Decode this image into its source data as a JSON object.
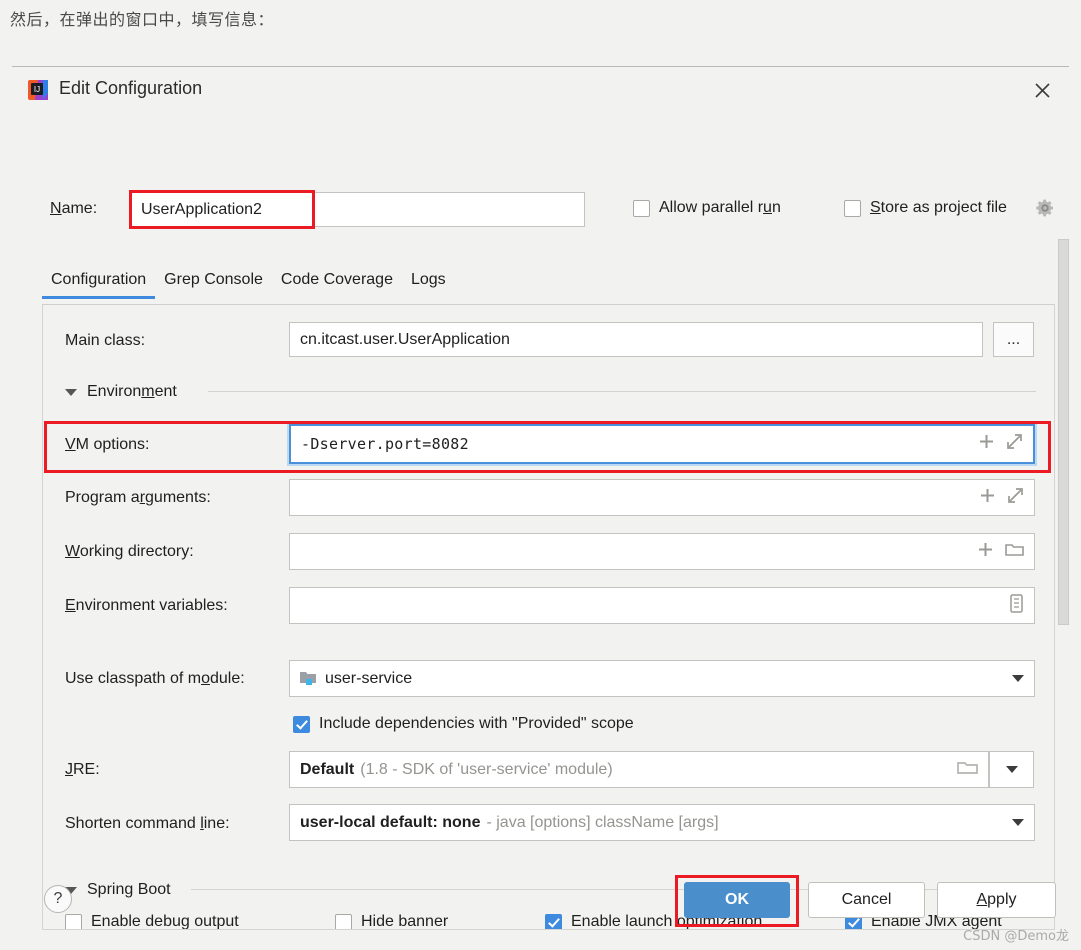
{
  "caption": "然后，在弹出的窗口中，填写信息：",
  "dialog": {
    "title": "Edit Configuration",
    "icon": "intellij-idea-icon",
    "close_icon": "close-icon"
  },
  "name_row": {
    "label": "Name:",
    "label_mnemonic": "N",
    "value": "UserApplication2",
    "placeholder": ""
  },
  "top_checkboxes": [
    {
      "label": "Allow parallel run",
      "mnemonic": "u",
      "checked": false
    },
    {
      "label": "Store as project file",
      "mnemonic": "S",
      "checked": false
    }
  ],
  "gear_icon": "gear-icon",
  "tabs": [
    {
      "label": "Configuration",
      "active": true
    },
    {
      "label": "Grep Console",
      "active": false
    },
    {
      "label": "Code Coverage",
      "active": false
    },
    {
      "label": "Logs",
      "active": false
    }
  ],
  "fields": {
    "main_class": {
      "label": "Main class:",
      "value": "cn.itcast.user.UserApplication",
      "browse_label": "..."
    },
    "environment_section": {
      "label": "Environment",
      "mnemonic": "m",
      "expanded": true
    },
    "vm_options": {
      "label": "VM options:",
      "label_mnemonic": "V",
      "value": "-Dserver.port=8082",
      "icons": [
        "plus-icon",
        "expand-icon"
      ],
      "focused": true,
      "highlighted": true
    },
    "program_arguments": {
      "label": "Program arguments:",
      "label_mnemonic": "r",
      "value": "",
      "icons": [
        "plus-icon",
        "expand-icon"
      ]
    },
    "working_directory": {
      "label": "Working directory:",
      "label_mnemonic": "W",
      "value": "",
      "icons": [
        "plus-icon",
        "folder-icon"
      ]
    },
    "environment_variables": {
      "label": "Environment variables:",
      "label_mnemonic": "E",
      "value": "",
      "icons": [
        "list-editor-icon"
      ]
    },
    "use_classpath": {
      "label": "Use classpath of module:",
      "label_mnemonic": "o",
      "value": "user-service",
      "icon": "module-folder-icon"
    },
    "include_dependencies": {
      "label": "Include dependencies with \"Provided\" scope",
      "checked": true
    },
    "jre": {
      "label": "JRE:",
      "label_mnemonic": "J",
      "value": "Default",
      "value_detail": "(1.8 - SDK of 'user-service' module)",
      "icons": [
        "folder-icon",
        "chevron-down-icon"
      ]
    },
    "shorten_command_line": {
      "label": "Shorten command line:",
      "label_mnemonic": "l",
      "value": "user-local default: none",
      "value_detail": "- java [options] className [args]"
    },
    "spring_boot_section": {
      "label": "Spring Boot",
      "expanded": true
    },
    "spring_boot_checkboxes": [
      {
        "label": "Enable debug output",
        "checked": false
      },
      {
        "label": "Hide banner",
        "checked": false
      },
      {
        "label": "Enable launch optimization",
        "checked": true
      },
      {
        "label": "Enable JMX agent",
        "checked": true
      }
    ]
  },
  "buttons": {
    "help": "?",
    "ok": "OK",
    "cancel": "Cancel",
    "apply": "Apply",
    "apply_mnemonic": "A"
  },
  "watermark": "CSDN @Demo龙",
  "colors": {
    "accent": "#3d8ade",
    "primary_button": "#4a8ecb",
    "highlight_red": "#ec1b23",
    "dialog_bg": "#f2f2f0"
  }
}
